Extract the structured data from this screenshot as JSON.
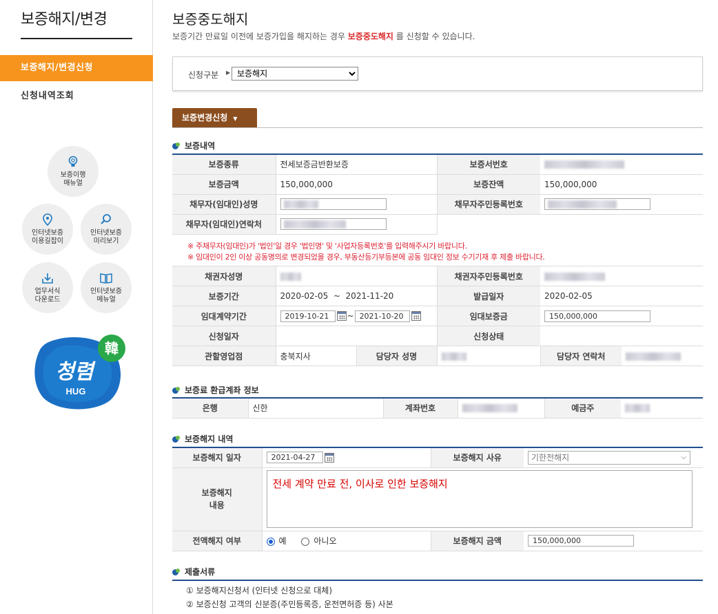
{
  "sidebar": {
    "title": "보증해지/변경",
    "menu_active": "보증해지/변경신청",
    "menu_item": "신청내역조회",
    "circles": [
      {
        "label": "보증이행\n매뉴얼",
        "icon": "lightbulb-icon"
      },
      {
        "label": "인터넷보증\n이용길잡이",
        "icon": "map-pin-icon"
      },
      {
        "label": "인터넷보증\n미리보기",
        "icon": "magnifier-icon"
      },
      {
        "label": "업무서식\n다운로드",
        "icon": "download-icon"
      },
      {
        "label": "인터넷보증\n메뉴얼",
        "icon": "book-icon"
      }
    ],
    "logo_text": "청렴",
    "logo_sub": "HUG",
    "logo_badge": "韓"
  },
  "page": {
    "title": "보증중도해지",
    "sub_before": "보증기간 만료일 이전에 보증가입을 해지하는 경우 ",
    "sub_highlight": "보증중도해지",
    "sub_after": " 를 신청할 수 있습니다."
  },
  "filter": {
    "label": "신청구분",
    "selected": "보증해지"
  },
  "tab": {
    "label": "보증변경신청"
  },
  "guarantee": {
    "section_title": "보증내역",
    "type_label": "보증종류",
    "type_value": "전세보증금반환보증",
    "cert_no_label": "보증서번호",
    "amount_label": "보증금액",
    "amount_value": "150,000,000",
    "balance_label": "보증잔액",
    "balance_value": "150,000,000",
    "debtor_name_label": "채무자(임대인)성명",
    "debtor_id_label": "채무자주민등록번호",
    "debtor_contact_label": "채무자(임대인)연락처",
    "notice_1": "※ 주채무자(임대인)가 '법인'일 경우 '법인명' 및 '사업자등록번호'를 입력해주시기 바랍니다.",
    "notice_2": "※ 임대인이 2인 이상 공동명의로 변경되었을 경우, 부동산등기부등본에 공동 임대인 정보 수기기재 후 제출 바랍니다.",
    "creditor_name_label": "채권자성명",
    "creditor_id_label": "채권자주민등록번호",
    "period_label": "보증기간",
    "period_value": "2020-02-05  ~  2021-11-20",
    "issue_date_label": "발급일자",
    "issue_date_value": "2020-02-05",
    "lease_period_label": "임대계약기간",
    "lease_start": "2019-10-21",
    "lease_sep": "~",
    "lease_end": "2021-10-20",
    "lease_deposit_label": "임대보증금",
    "lease_deposit_value": "150,000,000",
    "apply_date_label": "신청일자",
    "apply_status_label": "신청상태",
    "branch_label": "관할영업점",
    "branch_value": "충북지사",
    "manager_name_label": "담당자 성명",
    "manager_contact_label": "담당자 연락처"
  },
  "refund": {
    "section_title": "보증료 환급계좌 정보",
    "bank_label": "은행",
    "bank_value": "신한",
    "account_label": "계좌번호",
    "holder_label": "예금주"
  },
  "cancel": {
    "section_title": "보증해지 내역",
    "date_label": "보증해지 일자",
    "date_value": "2021-04-27",
    "reason_label": "보증해지 사유",
    "reason_value": "기한전해지",
    "content_label": "보증해지\n내용",
    "content_value": "전세 계약 만료 전, 이사로 인한 보증해지",
    "full_label": "전액해지 여부",
    "yes_label": "예",
    "no_label": "아니오",
    "amount_label": "보증해지 금액",
    "amount_value": "150,000,000"
  },
  "docs": {
    "section_title": "제출서류",
    "items": [
      "① 보증해지신청서 (인터넷 신청으로 대체)",
      "② 보증신청 고객의 신분증(주민등록증, 운전면허증 등) 사본"
    ]
  }
}
